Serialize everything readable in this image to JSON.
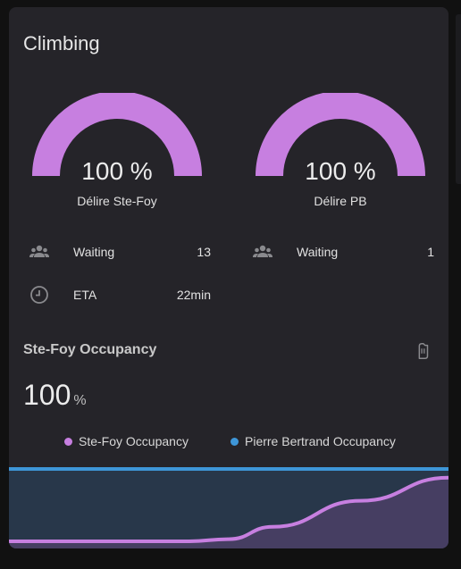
{
  "card": {
    "title": "Climbing"
  },
  "gauges": [
    {
      "name": "Délire Ste-Foy",
      "value": "100 %",
      "fill": 1.0
    },
    {
      "name": "Délire PB",
      "value": "100 %",
      "fill": 1.0
    }
  ],
  "rows": {
    "left_waiting": {
      "icon": "account-group-icon",
      "label": "Waiting",
      "value": "13"
    },
    "left_eta": {
      "icon": "clock-icon",
      "label": "ETA",
      "value": "22min"
    },
    "right_waiting": {
      "icon": "account-group-icon",
      "label": "Waiting",
      "value": "1"
    }
  },
  "history": {
    "title": "Ste-Foy Occupancy",
    "value": "100",
    "unit": "%",
    "icon": "hand-back-icon",
    "legend": [
      {
        "name": "Ste-Foy Occupancy",
        "color": "#c77fe0"
      },
      {
        "name": "Pierre Bertrand Occupancy",
        "color": "#3e96d8"
      }
    ]
  },
  "colors": {
    "accent": "#c77fe0",
    "blue": "#3e96d8",
    "card": "#252429",
    "background": "#111111"
  },
  "chart_data": {
    "type": "line",
    "y_range": [
      0,
      100
    ],
    "series": [
      {
        "name": "Ste-Foy Occupancy",
        "color": "#c77fe0",
        "x": [
          0,
          0.41,
          0.5,
          0.6,
          0.8,
          1.0
        ],
        "values": [
          0,
          0,
          3,
          20,
          56,
          88
        ]
      },
      {
        "name": "Pierre Bertrand Occupancy",
        "color": "#3e96d8",
        "x": [
          0,
          1.0
        ],
        "values": [
          100,
          100
        ]
      }
    ]
  }
}
